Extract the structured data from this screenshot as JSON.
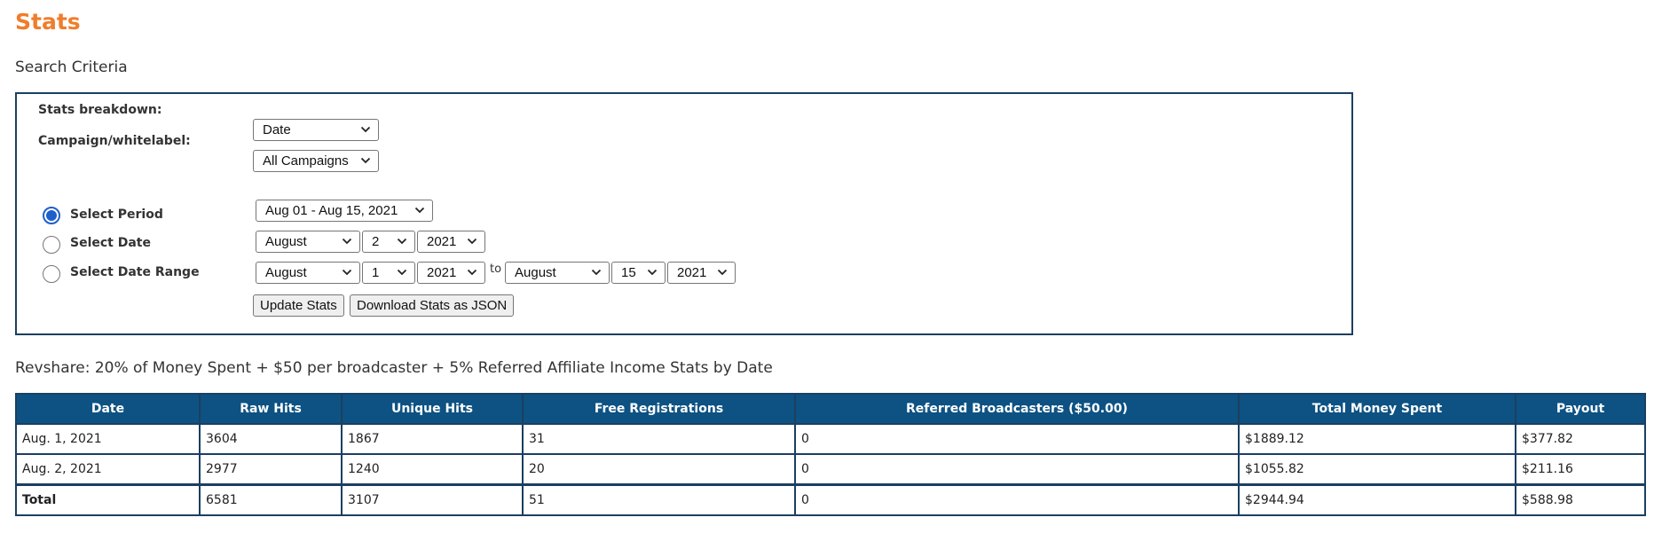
{
  "page": {
    "title": "Stats",
    "section_title": "Search Criteria"
  },
  "criteria": {
    "breakdown_label": "Stats breakdown:",
    "breakdown_value": "Date",
    "campaign_label": "Campaign/whitelabel:",
    "campaign_value": "All Campaigns",
    "period": {
      "label": "Select Period",
      "value": "Aug 01 - Aug 15, 2021",
      "selected": true
    },
    "date": {
      "label": "Select Date",
      "month": "August",
      "day": "2",
      "year": "2021",
      "selected": false
    },
    "range": {
      "label": "Select Date Range",
      "from_month": "August",
      "from_day": "1",
      "from_year": "2021",
      "to_label": "to",
      "to_month": "August",
      "to_day": "15",
      "to_year": "2021",
      "selected": false
    },
    "update_button": "Update Stats",
    "download_button": "Download Stats as JSON"
  },
  "stats": {
    "title": "Revshare: 20% of Money Spent + $50 per broadcaster + 5% Referred Affiliate Income Stats by Date",
    "columns": [
      "Date",
      "Raw Hits",
      "Unique Hits",
      "Free Registrations",
      "Referred Broadcasters ($50.00)",
      "Total Money Spent",
      "Payout"
    ],
    "rows": [
      [
        "Aug. 1, 2021",
        "3604",
        "1867",
        "31",
        "0",
        "$1889.12",
        "$377.82"
      ],
      [
        "Aug. 2, 2021",
        "2977",
        "1240",
        "20",
        "0",
        "$1055.82",
        "$211.16"
      ]
    ],
    "total": [
      "Total",
      "6581",
      "3107",
      "51",
      "0",
      "$2944.94",
      "$588.98"
    ]
  },
  "colors": {
    "title_orange": "#f07d2b",
    "header_blue": "#0d5283",
    "border_navy": "#1b3f61",
    "radio_blue": "#1f5fcc"
  },
  "icons": {
    "dropdown": "chevron-down-icon"
  }
}
